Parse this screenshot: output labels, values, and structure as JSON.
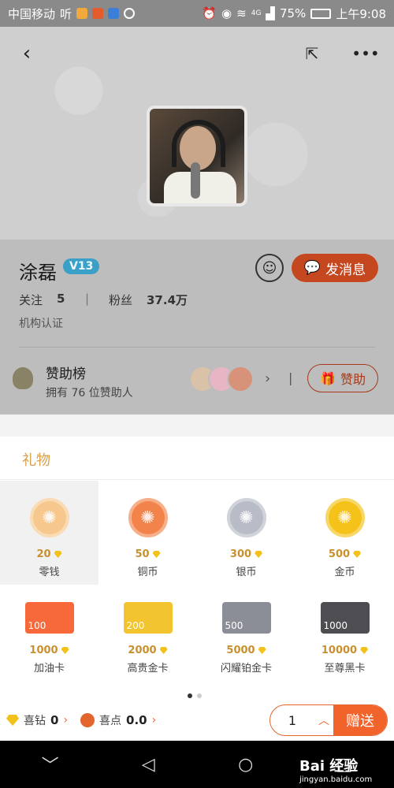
{
  "status_bar": {
    "carrier": "中国移动",
    "carrier_extra": "听",
    "battery": "75%",
    "time": "上午9:08",
    "signal": "4G"
  },
  "header": {
    "back_icon": "back-arrow-icon",
    "share_icon": "share-icon",
    "more_icon": "more-dots-icon"
  },
  "profile": {
    "name": "涂磊",
    "vip": "V13",
    "follow_label": "关注",
    "follow_count": "5",
    "fans_label": "粉丝",
    "fans_count": "37.4万",
    "certification": "机构认证",
    "message_button": "发消息"
  },
  "sponsor": {
    "title": "赞助榜",
    "subtitle": "拥有 76 位赞助人",
    "button": "赞助"
  },
  "gift_panel": {
    "title": "礼物",
    "gifts": [
      {
        "name": "零钱",
        "price": "20",
        "color": "#f6c88d"
      },
      {
        "name": "铜币",
        "price": "50",
        "color": "#f2844b"
      },
      {
        "name": "银币",
        "price": "300",
        "color": "#b8bcc6"
      },
      {
        "name": "金币",
        "price": "500",
        "color": "#f5c21a"
      },
      {
        "name": "加油卡",
        "price": "1000",
        "card_value": "100",
        "color": "#f7693a"
      },
      {
        "name": "高贵金卡",
        "price": "2000",
        "card_value": "200",
        "color": "#f2c530"
      },
      {
        "name": "闪耀铂金卡",
        "price": "5000",
        "card_value": "500",
        "color": "#8c8e97"
      },
      {
        "name": "至尊黑卡",
        "price": "10000",
        "card_value": "1000",
        "color": "#4d4d52"
      }
    ],
    "selected_index": 0
  },
  "wallet": {
    "diamond_label": "喜钻",
    "diamond_value": "0",
    "points_label": "喜点",
    "points_value": "0.0"
  },
  "send": {
    "quantity": "1",
    "button": "赠送"
  },
  "watermark": {
    "text": "Bai 经验",
    "sub": "jingyan.baidu.com"
  }
}
